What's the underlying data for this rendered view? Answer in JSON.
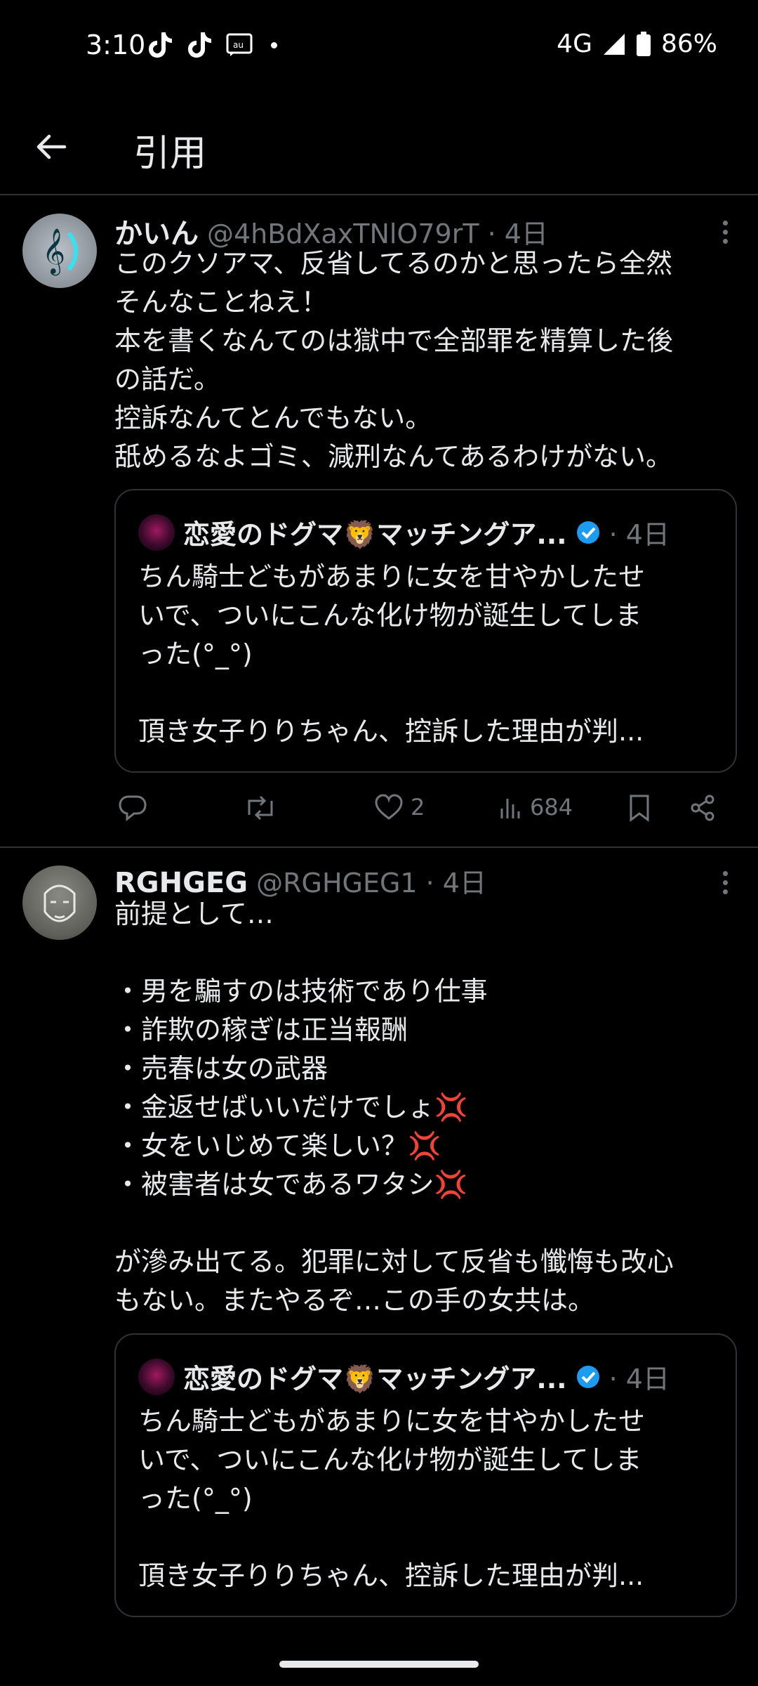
{
  "status": {
    "time": "3:10",
    "network": "4G",
    "battery": "86%"
  },
  "appbar": {
    "title": "引用"
  },
  "tweets": [
    {
      "name": "かいん",
      "handle": "@4hBdXaxTNlO79rT",
      "time": "· 4日",
      "text": "このクソアマ、反省してるのかと思ったら全然\nそんなことねえ！\n本を書くなんてのは獄中で全部罪を精算した後\nの話だ。\n控訴なんてとんでもない。\n舐めるなよゴミ、減刑なんてあるわけがない。",
      "quote": {
        "name": "恋愛のドグマ🦁マッチングア...",
        "time": "· 4日",
        "text": "ちん騎士どもがあまりに女を甘やかしたせ\nいで、ついにこんな化け物が誕生してしま\nった(°_°)\n\n頂き女子りりちゃん、控訴した理由が判..."
      },
      "actions": {
        "likes": "2",
        "views": "684"
      }
    },
    {
      "name": "RGHGEG",
      "handle": "@RGHGEG1",
      "time": "· 4日",
      "text": "前提として…\n\n・男を騙すのは技術であり仕事\n・詐欺の稼ぎは正当報酬\n・売春は女の武器\n・金返せばいいだけでしょ💢\n・女をいじめて楽しい？💢\n・被害者は女であるワタシ💢\n\nが滲み出てる。犯罪に対して反省も懺悔も改心\nもない。またやるぞ…この手の女共は。",
      "quote": {
        "name": "恋愛のドグマ🦁マッチングア...",
        "time": "· 4日",
        "text": "ちん騎士どもがあまりに女を甘やかしたせ\nいで、ついにこんな化け物が誕生してしま\nった(°_°)\n\n頂き女子りりちゃん、控訴した理由が判..."
      }
    }
  ],
  "colors": {
    "background": "#000000",
    "text": "#e7e9ea",
    "muted": "#71767b",
    "border": "#2f3336",
    "verified": "#1d9bf0"
  }
}
